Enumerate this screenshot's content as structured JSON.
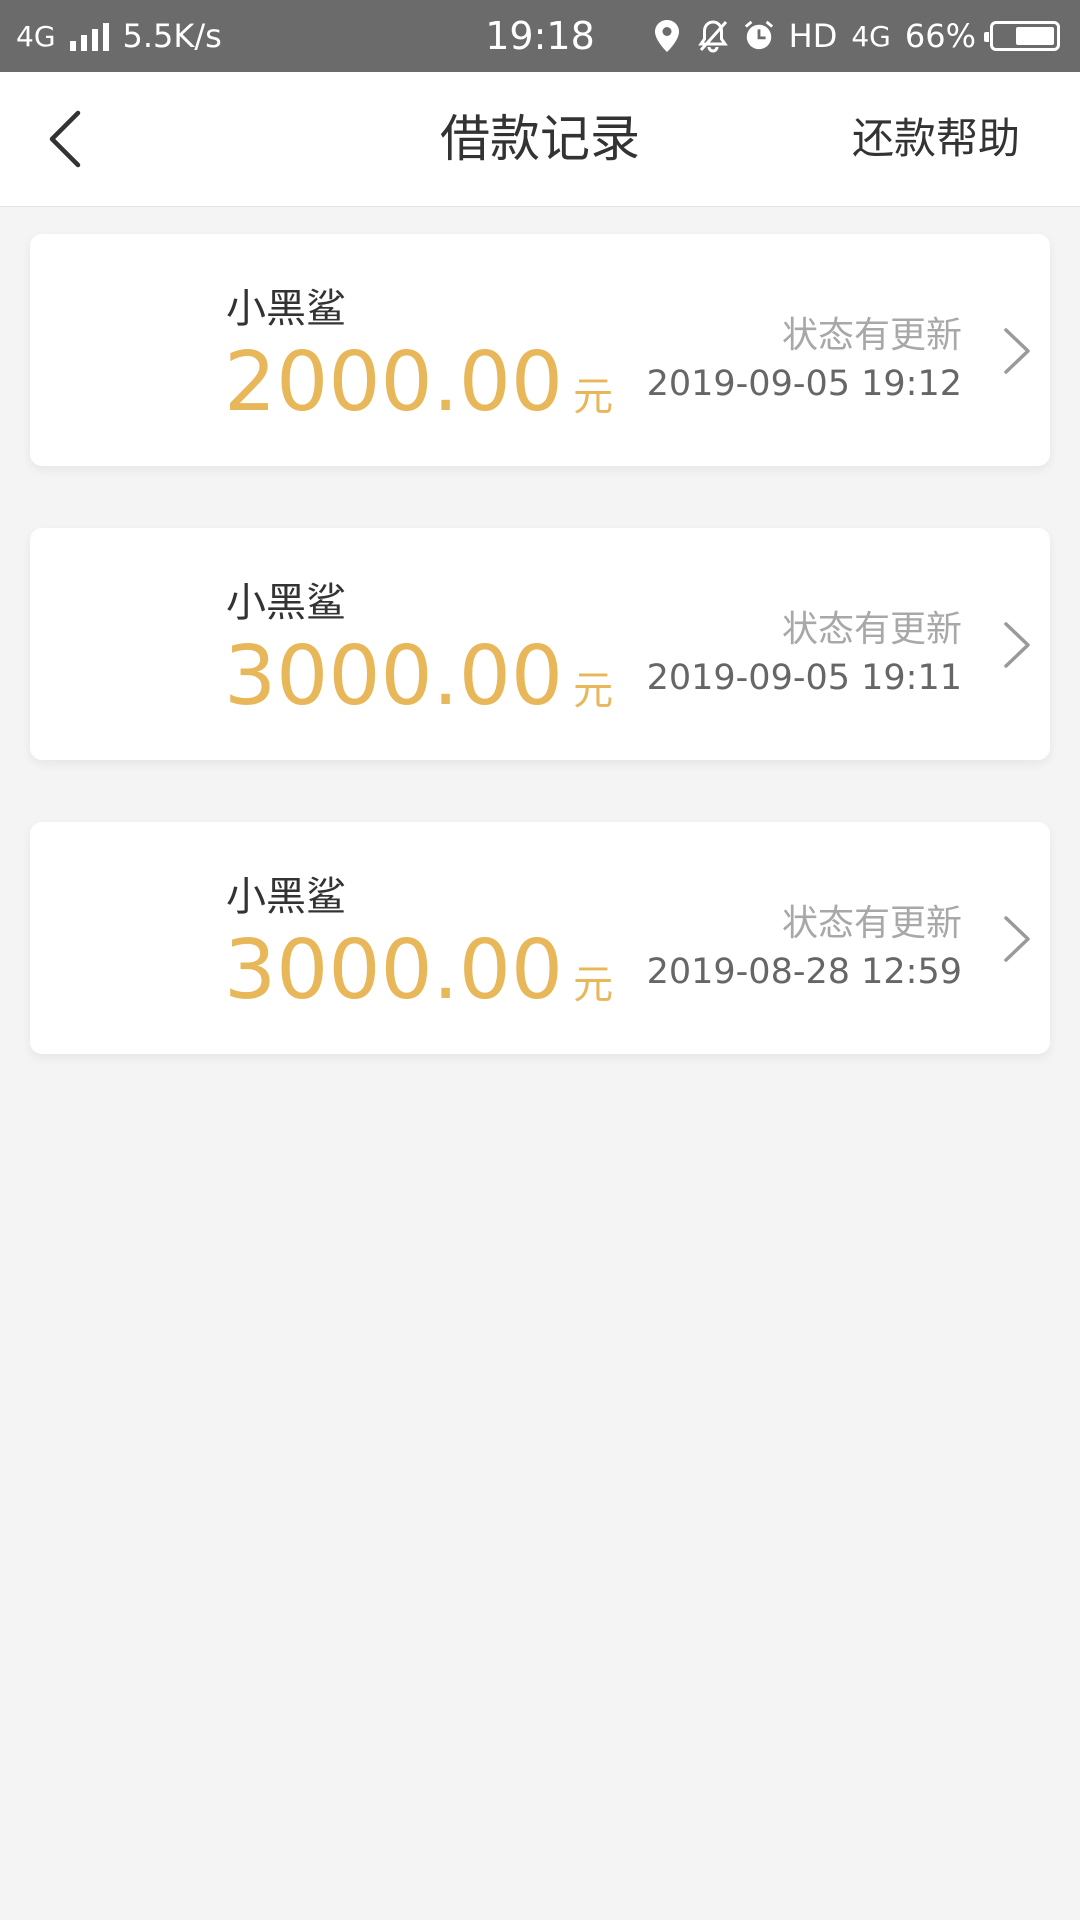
{
  "status_bar": {
    "network_type": "4G",
    "speed": "5.5K/s",
    "time": "19:18",
    "hd": "HD",
    "network_type_right": "4G",
    "battery_percent": "66%",
    "battery_level": 0.66
  },
  "nav": {
    "title": "借款记录",
    "help_label": "还款帮助",
    "back_icon": "chevron-left-icon"
  },
  "records": [
    {
      "name": "小黑鲨",
      "amount": "2000.00",
      "unit": "元",
      "status": "状态有更新",
      "time": "2019-09-05 19:12"
    },
    {
      "name": "小黑鲨",
      "amount": "3000.00",
      "unit": "元",
      "status": "状态有更新",
      "time": "2019-09-05 19:11"
    },
    {
      "name": "小黑鲨",
      "amount": "3000.00",
      "unit": "元",
      "status": "状态有更新",
      "time": "2019-08-28 12:59"
    }
  ],
  "colors": {
    "amount": "#e8b75a",
    "status_bar_bg": "#6b6b6b",
    "page_bg": "#f4f4f4"
  }
}
